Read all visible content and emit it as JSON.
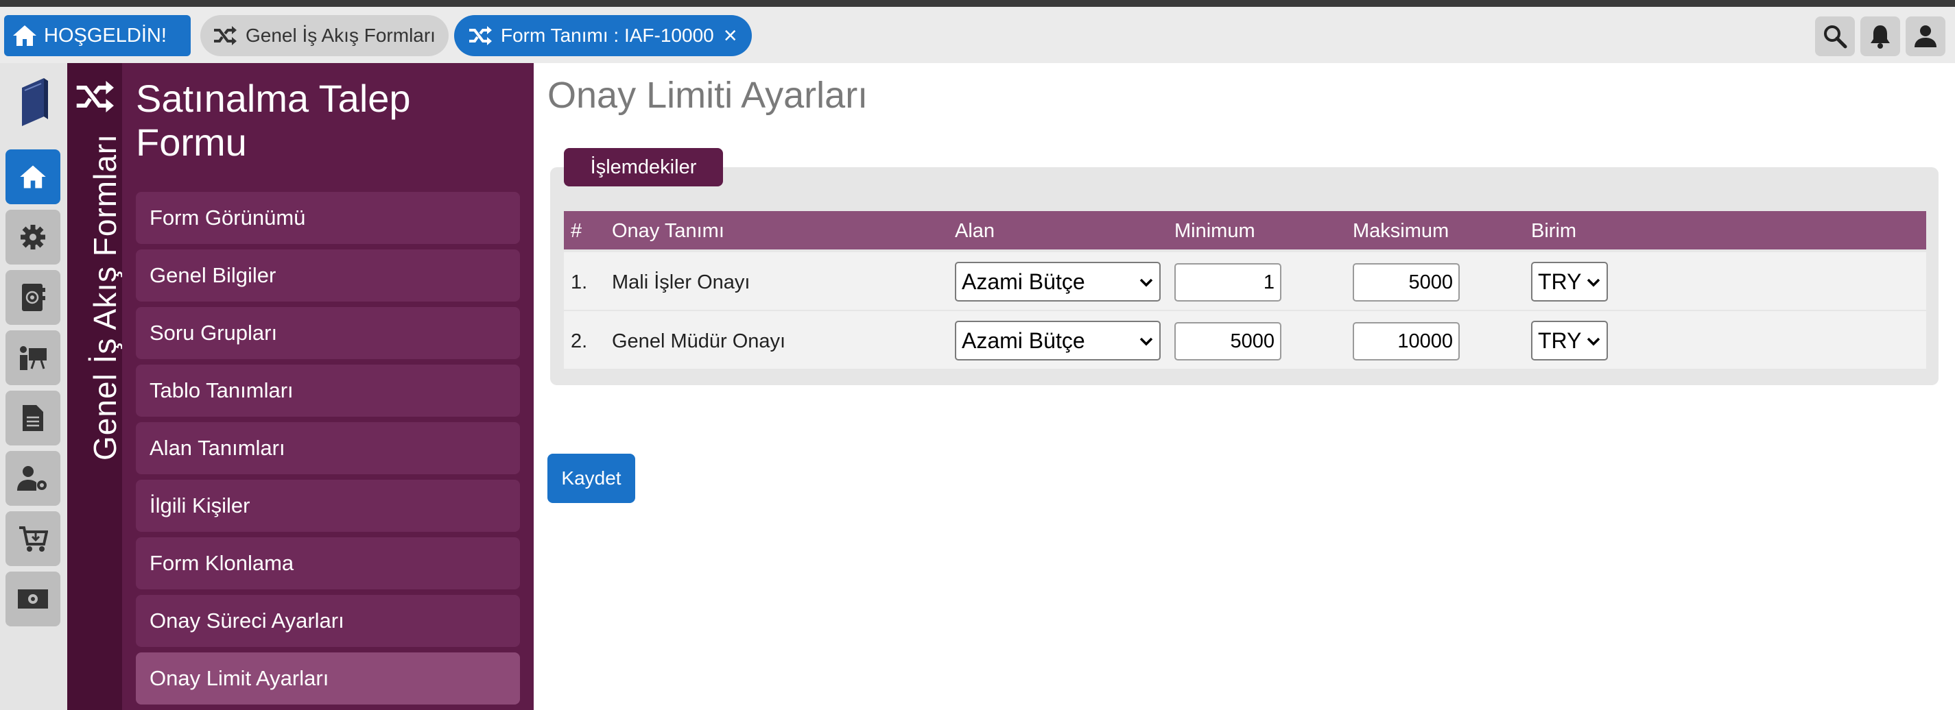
{
  "topbar": {
    "home_tab": "HOŞGELDİN!",
    "tabs": [
      {
        "label": "Genel İş Akış Formları",
        "icon": "shuffle-icon"
      },
      {
        "label": "Form Tanımı : IAF-10000",
        "icon": "shuffle-icon",
        "close": "×"
      }
    ],
    "right_icons": [
      "search-icon",
      "bell-icon",
      "user-icon"
    ]
  },
  "rail": {
    "items": [
      "home-icon",
      "gear-icon",
      "address-book-icon",
      "presentation-icon",
      "document-icon",
      "user-settings-icon",
      "cart-icon",
      "money-icon"
    ]
  },
  "module": {
    "vertical_title": "Genel İş Akış Formları"
  },
  "sidemenu": {
    "title": "Satınalma Talep Formu",
    "items": [
      "Form Görünümü",
      "Genel Bilgiler",
      "Soru Grupları",
      "Tablo Tanımları",
      "Alan Tanımları",
      "İlgili Kişiler",
      "Form Klonlama",
      "Onay Süreci Ayarları",
      "Onay Limit Ayarları"
    ],
    "active_index": 8
  },
  "main": {
    "title": "Onay Limiti Ayarları",
    "panel_tab": "İşlemdekiler",
    "columns": [
      "#",
      "Onay Tanımı",
      "Alan",
      "Minimum",
      "Maksimum",
      "Birim"
    ],
    "rows": [
      {
        "no": "1.",
        "name": "Mali İşler Onayı",
        "field": "Azami Bütçe",
        "min": "1",
        "max": "5000",
        "unit": "TRY"
      },
      {
        "no": "2.",
        "name": "Genel Müdür Onayı",
        "field": "Azami Bütçe",
        "min": "5000",
        "max": "10000",
        "unit": "TRY"
      }
    ],
    "save_label": "Kaydet"
  },
  "colors": {
    "accent_blue": "#1a72c8",
    "menu_purple": "#5e1c48",
    "header_purple": "#8b5079"
  }
}
